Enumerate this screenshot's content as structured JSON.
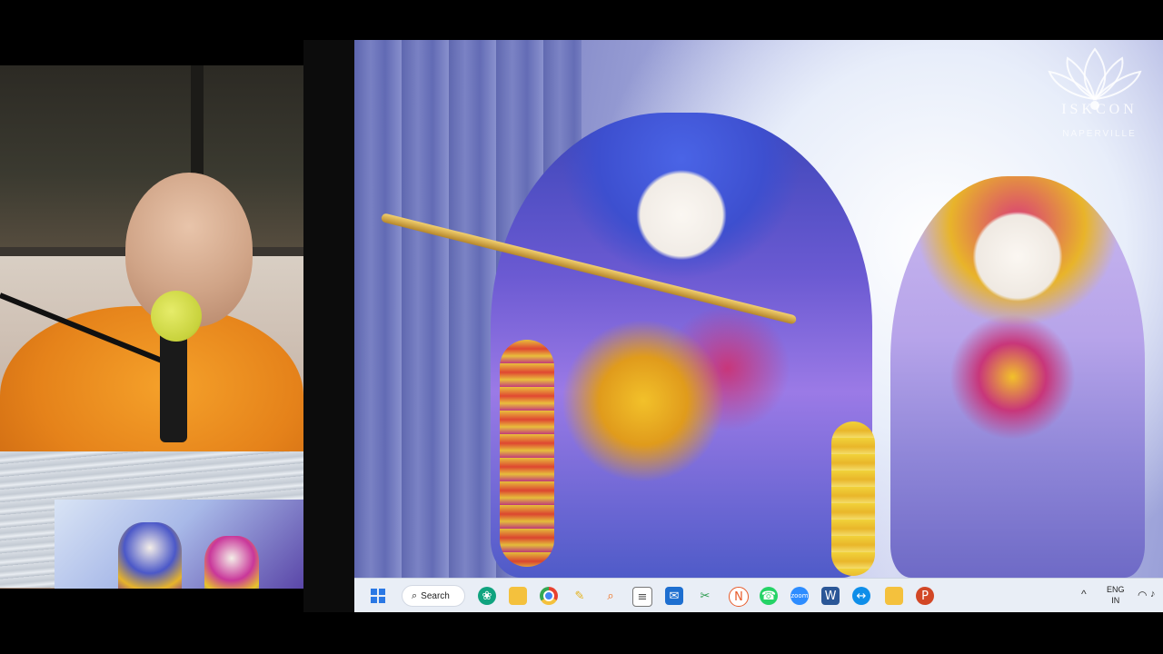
{
  "logo": {
    "name": "ISKCON",
    "subtitle": "NAPERVILLE"
  },
  "taskbar": {
    "search_label": "Search",
    "icons": [
      {
        "name": "start",
        "color": "#2b78e4"
      },
      {
        "name": "search"
      },
      {
        "name": "chatgpt-app",
        "color": "#10a37f"
      },
      {
        "name": "file-explorer",
        "color": "#f4c13d"
      },
      {
        "name": "chrome",
        "color": "#e8412f"
      },
      {
        "name": "pen-app",
        "color": "#e4b21c"
      },
      {
        "name": "search-app",
        "color": "#f06a14"
      },
      {
        "name": "book-app",
        "color": "#555555"
      },
      {
        "name": "mail-app",
        "color": "#1e6fd0"
      },
      {
        "name": "snipping-tool",
        "color": "#2d9c4f"
      },
      {
        "name": "notion-like-app",
        "color": "#e85b2a"
      },
      {
        "name": "whatsapp",
        "color": "#25d366",
        "badge": "6"
      },
      {
        "name": "zoom",
        "color": "#2d8cff",
        "label": "zoom"
      },
      {
        "name": "word",
        "color": "#2b5797",
        "label": "W"
      },
      {
        "name": "teamviewer",
        "color": "#0e8ee9"
      },
      {
        "name": "folder",
        "color": "#f4c13d"
      },
      {
        "name": "powerpoint",
        "color": "#d24726"
      }
    ],
    "tray": {
      "chevron": "^",
      "lang_top": "ENG",
      "lang_bottom": "IN"
    }
  }
}
